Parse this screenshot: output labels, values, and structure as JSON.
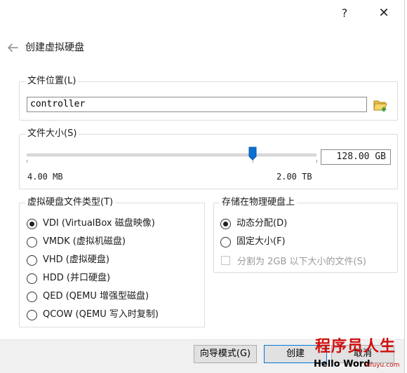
{
  "window": {
    "help_label": "?",
    "close_label": "✕"
  },
  "header": {
    "title": "创建虚拟硬盘",
    "back_icon": "arrow-left-icon"
  },
  "file_location": {
    "group_label": "文件位置(L)",
    "value": "controller",
    "folder_icon": "folder-open-icon"
  },
  "file_size": {
    "group_label": "文件大小(S)",
    "value": "128.00 GB",
    "min_label": "4.00 MB",
    "max_label": "2.00 TB",
    "slider_position": 0.78
  },
  "disk_type": {
    "group_label": "虚拟硬盘文件类型(T)",
    "options": [
      {
        "label": "VDI (VirtualBox 磁盘映像)",
        "checked": true
      },
      {
        "label": "VMDK (虚拟机磁盘)",
        "checked": false
      },
      {
        "label": "VHD (虚拟硬盘)",
        "checked": false
      },
      {
        "label": "HDD (并口硬盘)",
        "checked": false
      },
      {
        "label": "QED (QEMU 增强型磁盘)",
        "checked": false
      },
      {
        "label": "QCOW (QEMU 写入时复制)",
        "checked": false
      }
    ]
  },
  "storage": {
    "group_label": "存储在物理硬盘上",
    "options": [
      {
        "label": "动态分配(D)",
        "checked": true
      },
      {
        "label": "固定大小(F)",
        "checked": false
      }
    ],
    "split_label": "分割为 2GB 以下大小的文件(S)",
    "split_checked": false
  },
  "footer": {
    "expert_label": "向导模式(G)",
    "create_label": "创建",
    "cancel_label": "取消"
  },
  "watermark": {
    "main": "程序员人生",
    "sub": "Hello Word",
    "url": "wfuyu.com"
  },
  "colors": {
    "accent": "#0078d7",
    "watermark_red": "#d10f0f"
  }
}
